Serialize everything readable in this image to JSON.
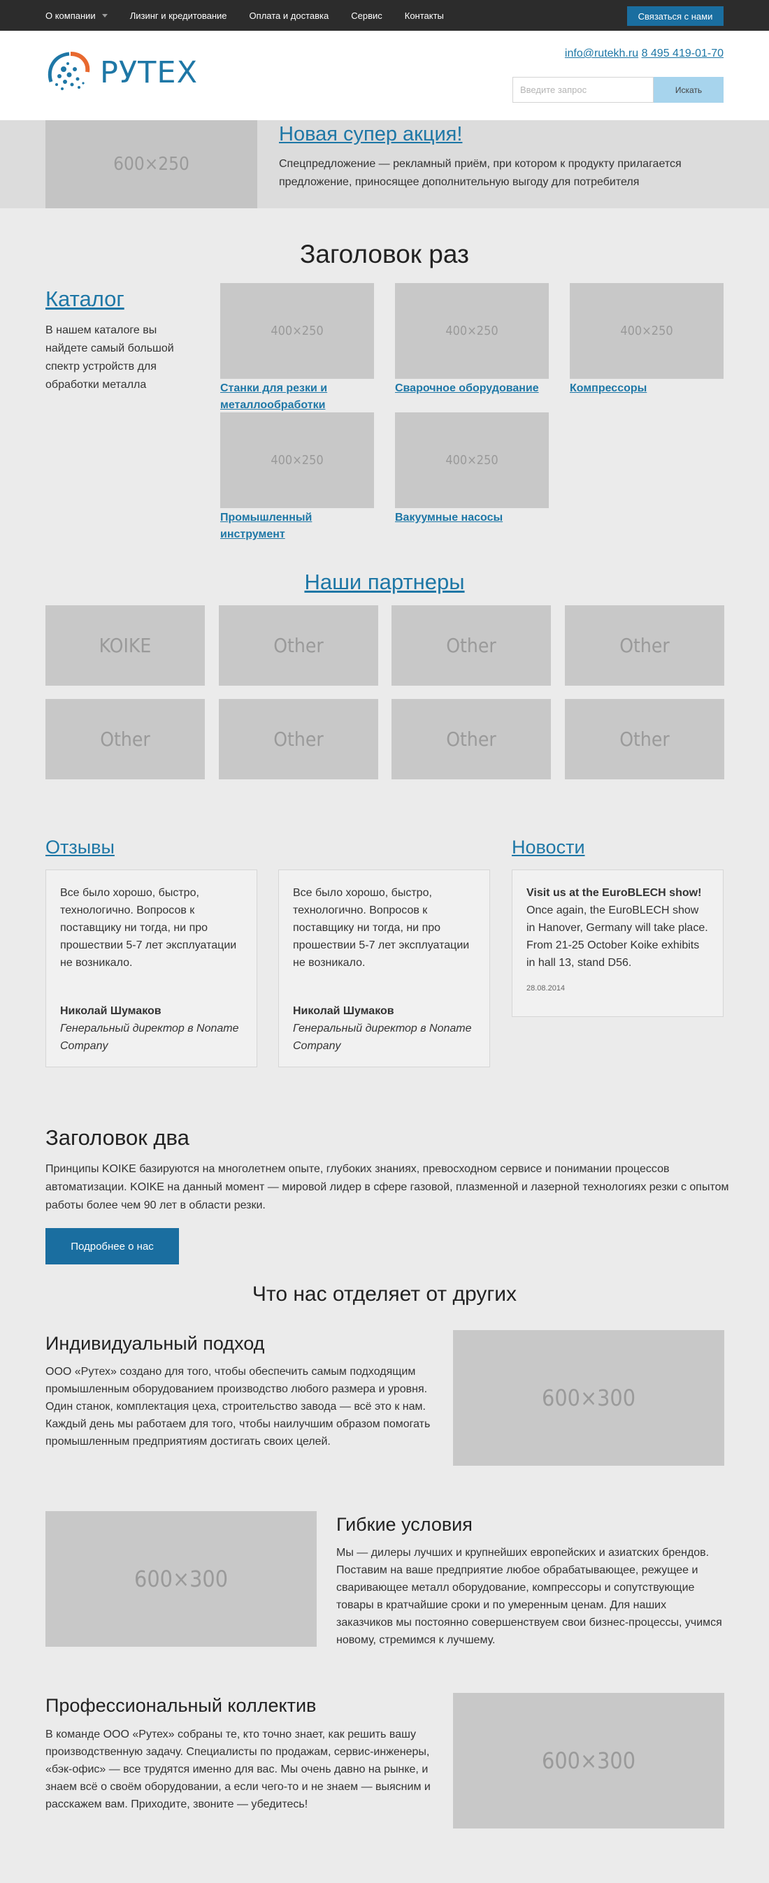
{
  "topnav": {
    "items": [
      "О компании",
      "Лизинг и кредитование",
      "Оплата и доставка",
      "Сервис",
      "Контакты"
    ],
    "contact_button": "Связаться с нами"
  },
  "header": {
    "logo_text": "РУТЕХ",
    "email": "info@rutekh.ru",
    "phone": "8 495 419-01-70",
    "search_placeholder": "Введите запрос",
    "search_button": "Искать"
  },
  "promo": {
    "image": "600×250",
    "title": "Новая супер акция!",
    "text": "Спецпредложение — рекламный приём, при котором к продукту прилагается предложение, приносящее дополнительную выгоду для потребителя"
  },
  "heading_one": "Заголовок раз",
  "catalog": {
    "title": "Каталог",
    "text": "В нашем каталоге вы найдете самый большой спектр устройств для обработки металла",
    "items": [
      {
        "image": "400×250",
        "label": "Станки для резки и металлообработки"
      },
      {
        "image": "400×250",
        "label": "Сварочное оборудование"
      },
      {
        "image": "400×250",
        "label": "Компрессоры"
      },
      {
        "image": "400×250",
        "label": "Промышленный инструмент"
      },
      {
        "image": "400×250",
        "label": "Вакуумные насосы"
      }
    ]
  },
  "partners": {
    "title": "Наши партнеры",
    "items": [
      "KOIKE",
      "Other",
      "Other",
      "Other",
      "Other",
      "Other",
      "Other",
      "Other"
    ]
  },
  "reviews": {
    "title": "Отзывы",
    "items": [
      {
        "text": "Все было хорошо, быстро, технологично. Вопросов к поставщику ни тогда, ни про прошествии 5-7 лет эксплуатации не возникало.",
        "author": "Николай Шумаков",
        "role": "Генеральный директор в Noname Company"
      },
      {
        "text": "Все было хорошо, быстро, технологично. Вопросов к поставщику ни тогда, ни про прошествии 5-7 лет эксплуатации не возникало.",
        "author": "Николай Шумаков",
        "role": "Генеральный директор в Noname Company"
      }
    ]
  },
  "news": {
    "title": "Новости",
    "head": "Visit us at the EuroBLECH show!",
    "text": "Once again, the EuroBLECH show in Hanover, Germany will take place. From 21-25 October Koike exhibits in hall 13, stand D56.",
    "date": "28.08.2014"
  },
  "heading_two": {
    "title": "Заголовок два",
    "text": "Принципы KOIKE базируются на многолетнем опыте, глубоких знаниях, превосходном сервисе и понимании процессов автоматизации. KOIKE на данный момент — мировой лидер в сфере газовой, плазменной и лазерной технологиях резки с опытом работы более чем 90 лет в области резки.",
    "button": "Подробнее о нас"
  },
  "differences": {
    "title": "Что нас отделяет от других",
    "items": [
      {
        "title": "Индивидуальный подход",
        "text": "ООО «Рутех» создано для того, чтобы обеспечить самым подходящим промышленным оборудованием производство любого размера и уровня. Один станок, комплектация цеха, строительство завода — всё это к нам. Каждый день мы работаем для того, чтобы наилучшим образом помогать промышленным предприятиям достигать своих целей.",
        "image": "600×300"
      },
      {
        "title": "Гибкие условия",
        "text": "Мы — дилеры лучших и крупнейших европейских и азиатских брендов. Поставим на ваше предприятие любое обрабатывающее, режущее и сваривающее металл оборудование, компрессоры и сопутствующие товары в кратчайшие сроки и по умеренным ценам. Для наших заказчиков мы постоянно совершенствуем свои бизнес-процессы, учимся новому, стремимся к лучшему.",
        "image": "600×300"
      },
      {
        "title": "Профессиональный коллектив",
        "text": "В команде ООО «Рутех» собраны те, кто точно знает, как решить вашу производственную задачу. Специалисты по продажам, сервис-инженеры, «бэк-офис» — все трудятся именно для вас. Мы очень давно на рынке, и знаем всё о своём оборудовании, а если чего-то и не знаем — выясним и расскажем вам. Приходите, звоните — убедитесь!",
        "image": "600×300"
      }
    ]
  }
}
